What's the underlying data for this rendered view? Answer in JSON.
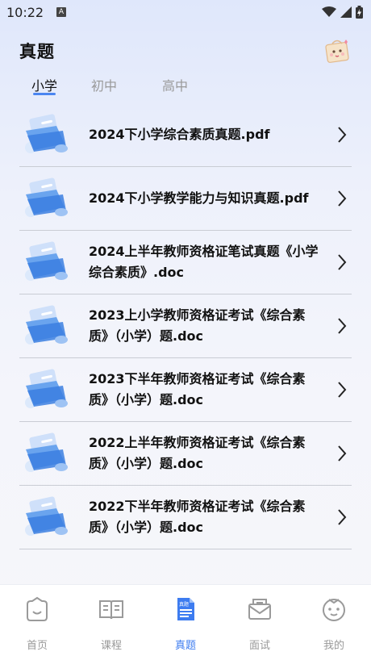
{
  "status": {
    "time": "10:22",
    "notification_badge": "A"
  },
  "page": {
    "title": "真题"
  },
  "tabs": [
    {
      "label": "小学",
      "active": true
    },
    {
      "label": "初中",
      "active": false
    },
    {
      "label": "高中",
      "active": false
    }
  ],
  "items": [
    {
      "title": "2024下小学综合素质真题.pdf"
    },
    {
      "title": "2024下小学教学能力与知识真题.pdf"
    },
    {
      "title": "2024上半年教师资格证笔试真题《小学综合素质》.doc"
    },
    {
      "title": "2023上小学教师资格证考试《综合素质》（小学）题.doc"
    },
    {
      "title": "2023下半年教师资格证考试《综合素质》（小学）题.doc"
    },
    {
      "title": "2022上半年教师资格证考试《综合素质》（小学）题.doc"
    },
    {
      "title": "2022下半年教师资格证考试《综合素质》（小学）题.doc"
    }
  ],
  "bottom_nav": [
    {
      "label": "首页",
      "icon": "home-icon",
      "active": false
    },
    {
      "label": "课程",
      "icon": "book-icon",
      "active": false
    },
    {
      "label": "真题",
      "icon": "document-icon",
      "active": true,
      "icon_text": "真题"
    },
    {
      "label": "面试",
      "icon": "mail-icon",
      "active": false
    },
    {
      "label": "我的",
      "icon": "profile-icon",
      "active": false
    }
  ],
  "colors": {
    "accent": "#3d7cf0",
    "inactive": "#999999",
    "divider": "#c9ccd4"
  }
}
